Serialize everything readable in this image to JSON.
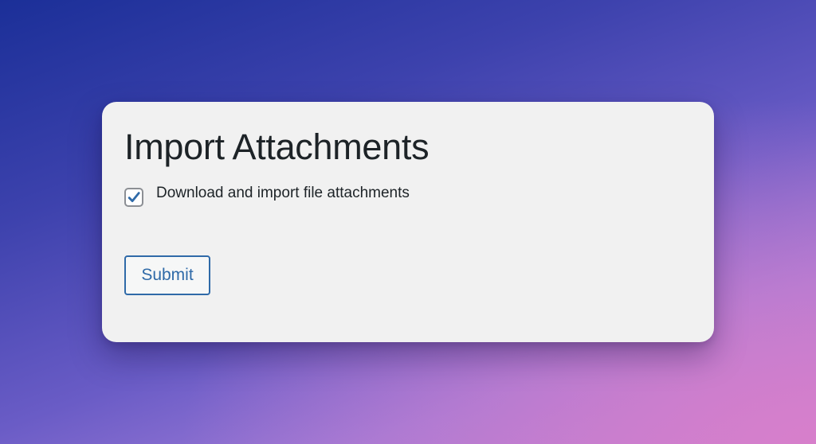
{
  "form": {
    "title": "Import Attachments",
    "checkbox": {
      "label": "Download and import file attachments",
      "checked": true,
      "icon": "checkmark-icon"
    },
    "submit_label": "Submit"
  },
  "colors": {
    "card_background": "#f1f1f1",
    "text": "#1d2327",
    "accent": "#2f6aa8",
    "checkbox_border": "#8c8f94"
  }
}
